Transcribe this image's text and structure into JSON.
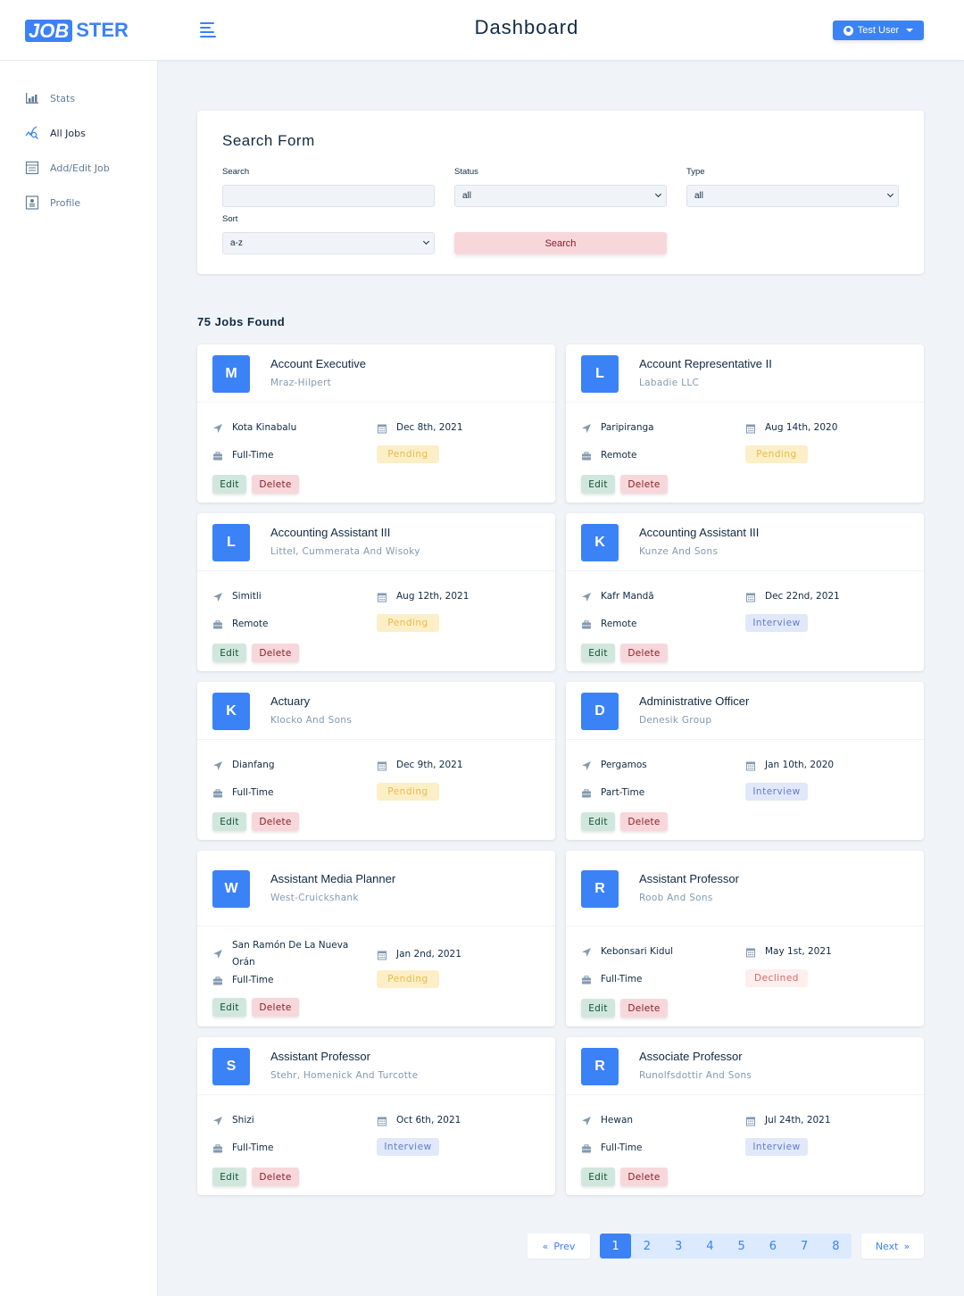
{
  "brand": {
    "logo_box": "JOB",
    "logo_rest": "STER"
  },
  "header": {
    "title": "Dashboard",
    "user_label": "Test User"
  },
  "colors": {
    "primary": "#3b82f6",
    "background": "#f0f4f8",
    "pending_bg": "#fcefc7",
    "pending_fg": "#e9b949",
    "interview_bg": "#e0e8f9",
    "interview_fg": "#647acb",
    "declined_bg": "#ffeeee",
    "declined_fg": "#d66a6a"
  },
  "sidebar": {
    "items": [
      {
        "label": "Stats",
        "icon": "bar-chart-icon",
        "active": false
      },
      {
        "label": "All Jobs",
        "icon": "search-chart-icon",
        "active": true
      },
      {
        "label": "Add/Edit Job",
        "icon": "form-icon",
        "active": false
      },
      {
        "label": "Profile",
        "icon": "profile-card-icon",
        "active": false
      }
    ]
  },
  "search_form": {
    "title": "Search Form",
    "search_label": "Search",
    "search_value": "",
    "status_label": "Status",
    "status_value": "all",
    "type_label": "Type",
    "type_value": "all",
    "sort_label": "Sort",
    "sort_value": "a-z",
    "submit_label": "Search"
  },
  "jobs_found": "75 Jobs Found",
  "job_actions": {
    "edit": "Edit",
    "delete": "Delete"
  },
  "jobs": [
    {
      "initial": "M",
      "position": "Account Executive",
      "company": "Mraz-Hilpert",
      "location": "Kota Kinabalu",
      "date": "Dec 8th, 2021",
      "type": "Full-Time",
      "status": "Pending"
    },
    {
      "initial": "L",
      "position": "Account Representative II",
      "company": "Labadie LLC",
      "location": "Paripiranga",
      "date": "Aug 14th, 2020",
      "type": "Remote",
      "status": "Pending"
    },
    {
      "initial": "L",
      "position": "Accounting Assistant III",
      "company": "Littel, Cummerata And Wisoky",
      "location": "Simitli",
      "date": "Aug 12th, 2021",
      "type": "Remote",
      "status": "Pending"
    },
    {
      "initial": "K",
      "position": "Accounting Assistant III",
      "company": "Kunze And Sons",
      "location": "Kafr Mandā",
      "date": "Dec 22nd, 2021",
      "type": "Remote",
      "status": "Interview"
    },
    {
      "initial": "K",
      "position": "Actuary",
      "company": "Klocko And Sons",
      "location": "Dianfang",
      "date": "Dec 9th, 2021",
      "type": "Full-Time",
      "status": "Pending"
    },
    {
      "initial": "D",
      "position": "Administrative Officer",
      "company": "Denesik Group",
      "location": "Pergamos",
      "date": "Jan 10th, 2020",
      "type": "Part-Time",
      "status": "Interview"
    },
    {
      "initial": "W",
      "position": "Assistant Media Planner",
      "company": "West-Cruickshank",
      "location": "San Ramón De La Nueva Orán",
      "date": "Jan 2nd, 2021",
      "type": "Full-Time",
      "status": "Pending"
    },
    {
      "initial": "R",
      "position": "Assistant Professor",
      "company": "Roob And Sons",
      "location": "Kebonsari Kidul",
      "date": "May 1st, 2021",
      "type": "Full-Time",
      "status": "Declined"
    },
    {
      "initial": "S",
      "position": "Assistant Professor",
      "company": "Stehr, Homenick And Turcotte",
      "location": "Shizi",
      "date": "Oct 6th, 2021",
      "type": "Full-Time",
      "status": "Interview"
    },
    {
      "initial": "R",
      "position": "Associate Professor",
      "company": "Runolfsdottir And Sons",
      "location": "Hewan",
      "date": "Jul 24th, 2021",
      "type": "Full-Time",
      "status": "Interview"
    }
  ],
  "pagination": {
    "prev_label": "Prev",
    "next_label": "Next",
    "pages": [
      "1",
      "2",
      "3",
      "4",
      "5",
      "6",
      "7",
      "8"
    ],
    "current": "1"
  }
}
